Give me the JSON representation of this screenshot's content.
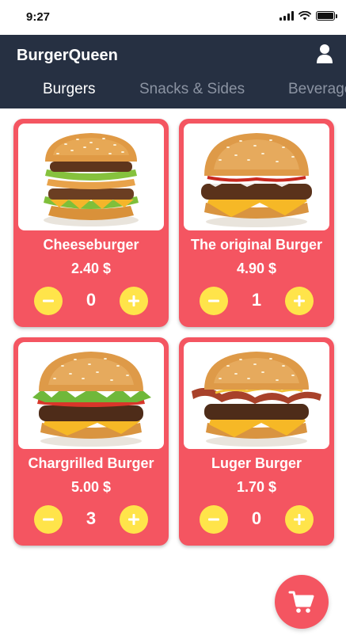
{
  "status_bar": {
    "time": "9:27"
  },
  "header": {
    "title": "BurgerQueen",
    "tabs": [
      {
        "label": "Burgers",
        "active": true
      },
      {
        "label": "Snacks & Sides",
        "active": false
      },
      {
        "label": "Beverages",
        "active": false
      }
    ]
  },
  "products": [
    {
      "name": "Cheeseburger",
      "price": "2.40 $",
      "quantity": "0",
      "image": "double-burger-photo"
    },
    {
      "name": "The original Burger",
      "price": "4.90 $",
      "quantity": "1",
      "image": "cheeseburger-photo"
    },
    {
      "name": "Chargrilled Burger",
      "price": "5.00 $",
      "quantity": "3",
      "image": "chargrilled-burger-photo"
    },
    {
      "name": "Luger Burger",
      "price": "1.70 $",
      "quantity": "0",
      "image": "bacon-burger-photo"
    }
  ],
  "icons": {
    "profile": "person-icon",
    "minus": "minus-icon",
    "plus": "plus-icon",
    "cart": "shopping-cart-icon"
  },
  "colors": {
    "header_bg": "#263042",
    "card_bg": "#f45561",
    "button_bg": "#ffe44a",
    "inactive_tab": "#8b93a2"
  }
}
